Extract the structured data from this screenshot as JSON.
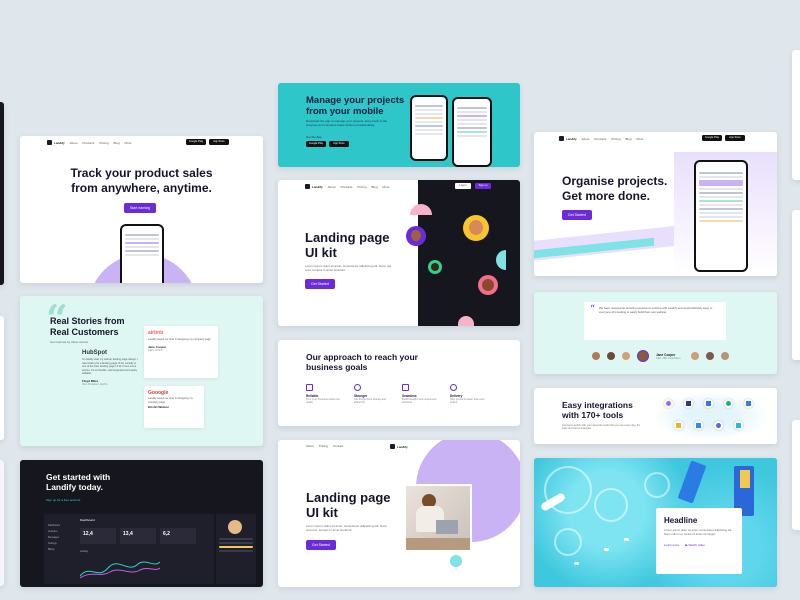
{
  "colors": {
    "background": "#dfe6ec",
    "purple": "#6c2bd9",
    "lavender": "#c9b3f5",
    "mint": "#dff7f2",
    "teal": "#2fc6c9",
    "dark": "#16161e"
  },
  "logo": "Landify",
  "nav": {
    "items": [
      "About",
      "Products",
      "Pricing",
      "Blog",
      "More"
    ],
    "items_short": [
      "About",
      "Pricing",
      "Contact"
    ]
  },
  "stores": {
    "google": "Google Play",
    "apple": "App Store"
  },
  "cards": {
    "mobile": {
      "title_line1": "Manage your projects",
      "title_line2": "from your mobile",
      "body": "Download the app to manage your projects, keep track of the progress and complete tasks without procastinating.",
      "cta": "Get the App"
    },
    "track": {
      "title_line1": "Track your product sales",
      "title_line2": "from anywhere, anytime.",
      "button": "Start earning"
    },
    "landing_dark": {
      "title_line1": "Landing page",
      "title_line2": "UI kit",
      "body": "Lorem ipsum dolor sit amet, consectetur adipiscing elit. Nunc nisl eros, tempus in amet tincidunt.",
      "button": "Get Started",
      "login": "Log in",
      "signup": "Sign up"
    },
    "organise": {
      "title_line1": "Organise projects.",
      "title_line2": "Get more done.",
      "button": "Get Started"
    },
    "stories": {
      "title_line1": "Real Stories from",
      "title_line2": "Real Customers",
      "sub": "Get inspired by these stories.",
      "brand1": "HubSpot",
      "quote1": "To quickly start my startup landing page design, I was looking for a landing page UI kit. Landify is one of the best landing page UI kit I have come across. It's so flexible, well organised and easily editable.",
      "name1": "Floyd Miles",
      "role1": "Vice President, GoPro",
      "brand2": "airbnb",
      "quote2": "Landify saved our time in designing my company page.",
      "name2": "Jane Cooper",
      "role2": "CEO, Airbnb",
      "brand3": "Gooogle",
      "quote3": "Landify saved our time in designing my company page.",
      "name3": "Kristin Watson",
      "role3": "Co-Founder, BookMyShow"
    },
    "testimonial": {
      "quote": "We have received an amazing experience working with Landify and would definitely keep to everyone who looking to easily build their own website.",
      "name": "Jane Cooper",
      "role": "CEO, ABC Corporation"
    },
    "approach": {
      "title_line1": "Our approach to reach your",
      "title_line2": "business goals",
      "features": [
        {
          "name": "Reliable",
          "desc": "Turn your business ideas into reality"
        },
        {
          "name": "Stronger",
          "desc": "Get things done quickly and efficiently"
        },
        {
          "name": "Seamless",
          "desc": "Build beautiful and responsive websites"
        },
        {
          "name": "Delivery",
          "desc": "Ship products faster than ever before"
        }
      ]
    },
    "integrations": {
      "title_line1": "Easy integrations",
      "title_line2": "with 170+ tools",
      "body": "Connect Landify with your favourite tools that you use every day. It's easy and fast to integrate."
    },
    "get_started": {
      "title_line1": "Get started with",
      "title_line2": "Landify today.",
      "link": "Sign up for a free account",
      "dash_title": "Dashboard",
      "menu": [
        "Dashboard",
        "Analytics",
        "Messages",
        "Settings",
        "Billing"
      ],
      "stats": [
        "12,4",
        "13,4",
        "6,2"
      ],
      "activity": "Activity"
    },
    "landing_light": {
      "title_line1": "Landing page",
      "title_line2": "UI kit",
      "body": "Lorem ipsum dolor sit amet, consectetur adipiscing elit. Nunc nisl eros, tempus in amet tincidunt.",
      "button": "Get Started"
    },
    "headline": {
      "title": "Headline",
      "body": "Lorem ipsum dolor sit amet, consectetur adipiscing elit. Nunc odio in et, lectus sit lorem id integer.",
      "link1": "Learn more",
      "link2": "Watch video"
    }
  }
}
